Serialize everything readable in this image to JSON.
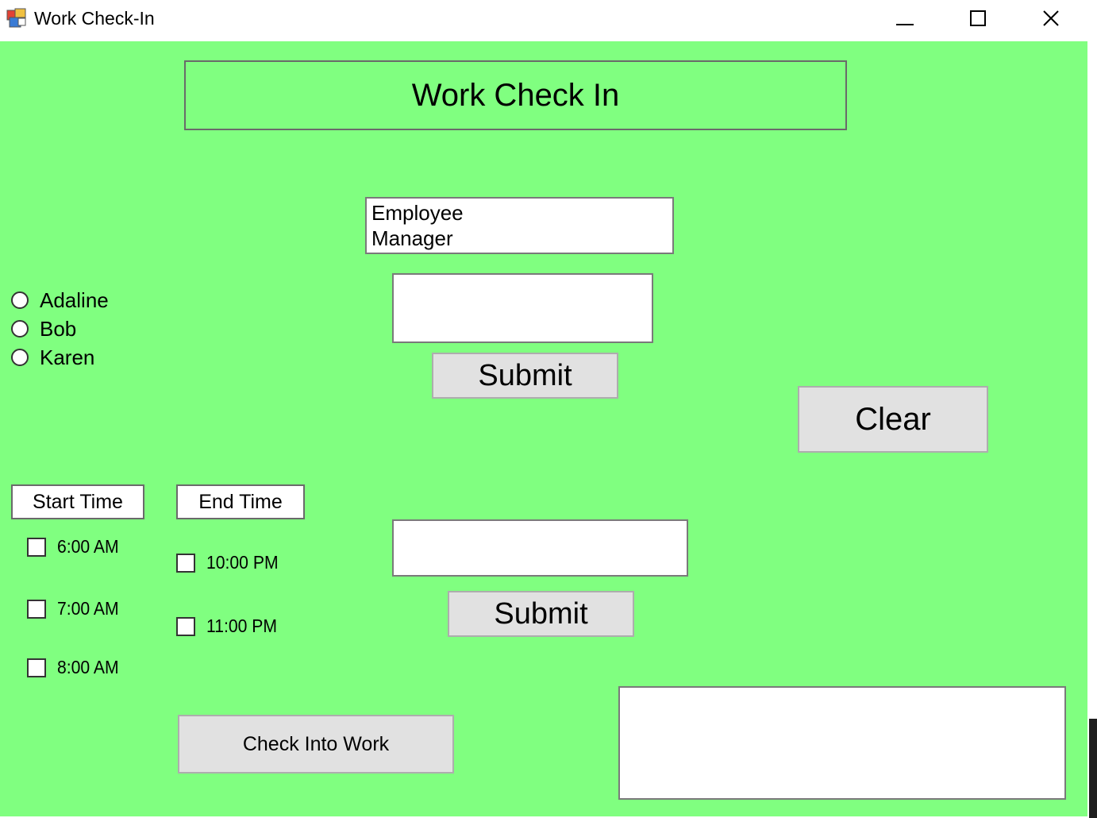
{
  "window": {
    "title": "Work Check-In",
    "controls": {
      "minimize": "minimize-icon",
      "maximize": "maximize-icon",
      "close": "close-icon"
    }
  },
  "colors": {
    "client_background": "#80ff80",
    "button_face": "#e1e1e1"
  },
  "header": {
    "title": "Work Check In"
  },
  "role_list": {
    "items": [
      "Employee",
      "Manager"
    ]
  },
  "name_input": {
    "value": ""
  },
  "submit_top": {
    "label": "Submit"
  },
  "clear_button": {
    "label": "Clear"
  },
  "employees": {
    "options": [
      "Adaline",
      "Bob",
      "Karen"
    ]
  },
  "start_time": {
    "label": "Start Time",
    "options": [
      "6:00 AM",
      "7:00 AM",
      "8:00 AM"
    ]
  },
  "end_time": {
    "label": "End Time",
    "options": [
      "10:00 PM",
      "11:00 PM"
    ]
  },
  "second_input": {
    "value": ""
  },
  "submit_bottom": {
    "label": "Submit"
  },
  "check_in_button": {
    "label": "Check Into Work"
  },
  "output_box": {
    "value": ""
  }
}
